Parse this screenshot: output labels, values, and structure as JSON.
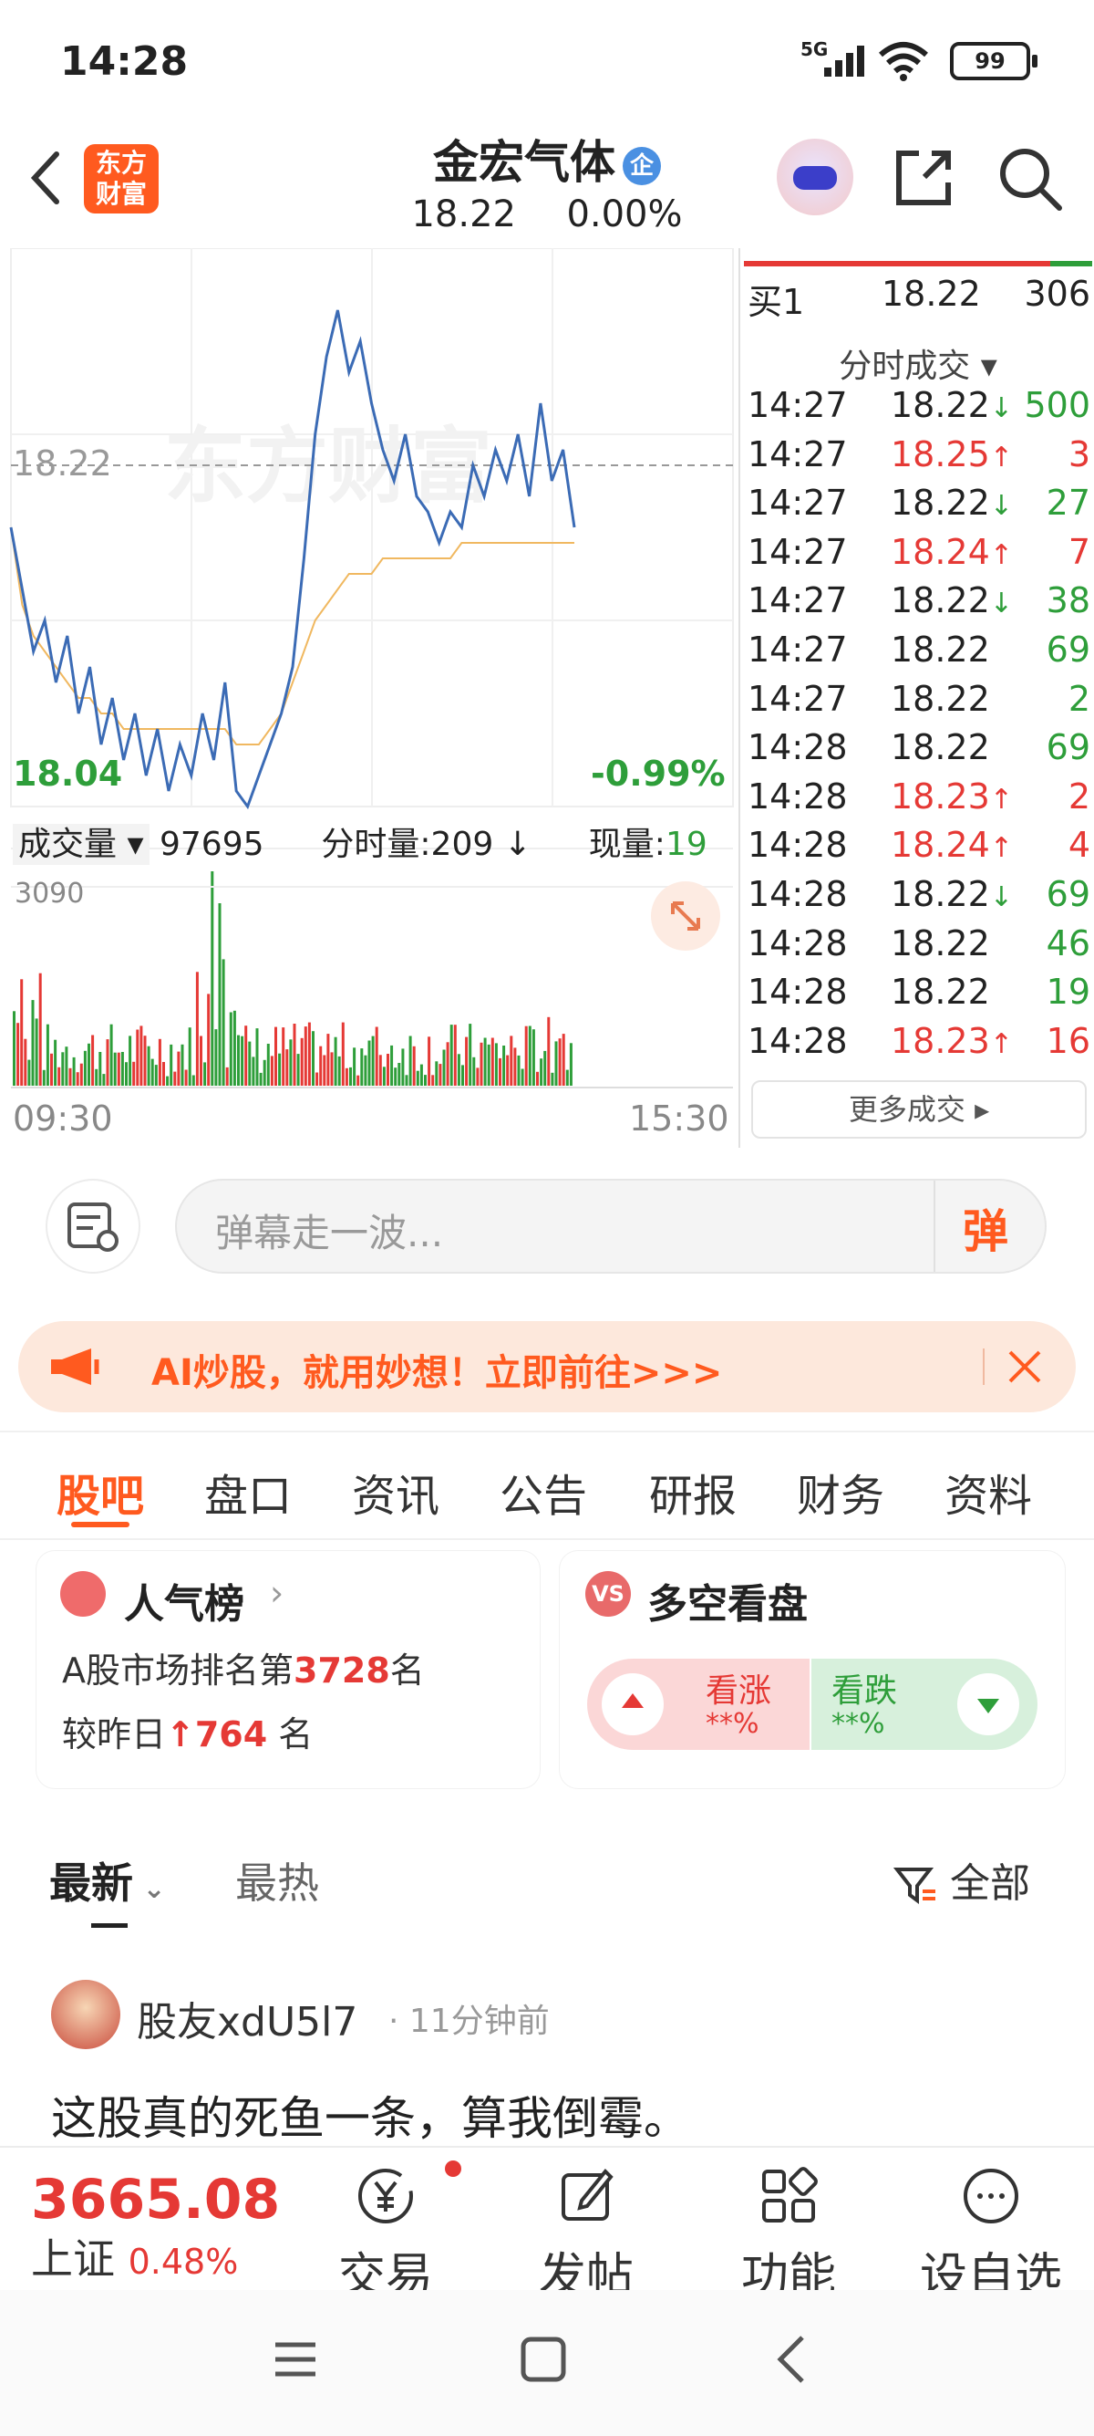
{
  "status": {
    "time": "14:28",
    "network": "5G",
    "battery": "99"
  },
  "header": {
    "logo_text_line1": "东方",
    "logo_text_line2": "财富",
    "stock_name": "金宏气体",
    "stock_tag": "企",
    "price": "18.22",
    "change_pct": "0.00%"
  },
  "chart": {
    "current_price_label": "18.22",
    "low_label": "18.04",
    "low_pct": "-0.99%",
    "volume_label": "成交量",
    "volume_value": "97695",
    "tick_volume_label": "分时量:209",
    "tick_volume_arrow": "↓",
    "now_volume_label": "现量:",
    "now_volume_value": "19",
    "vol_max": "3090",
    "time_start": "09:30",
    "time_end": "15:30",
    "watermark": "东方财富"
  },
  "chart_data": {
    "type": "line",
    "title": "",
    "series": [
      {
        "name": "",
        "values": [
          18.22,
          18.18,
          18.14,
          18.16,
          18.12,
          18.15,
          18.1,
          18.13,
          18.08,
          18.11,
          18.07,
          18.1,
          18.06,
          18.09,
          18.05,
          18.08,
          18.06,
          18.1,
          18.07,
          18.12,
          18.05,
          18.04,
          18.06,
          18.08,
          18.1,
          18.13,
          18.2,
          18.28,
          18.33,
          18.36,
          18.32,
          18.34,
          18.3,
          18.27,
          18.25,
          18.28,
          18.24,
          18.23,
          18.21,
          18.23,
          18.22,
          18.26,
          18.24,
          18.27,
          18.25,
          18.28,
          18.24,
          18.3,
          18.25,
          18.27,
          18.22
        ]
      },
      {
        "name": "",
        "values": [
          18.22,
          18.17,
          18.15,
          18.14,
          18.13,
          18.12,
          18.11,
          18.11,
          18.1,
          18.1,
          18.09,
          18.09,
          18.09,
          18.09,
          18.09,
          18.09,
          18.09,
          18.09,
          18.09,
          18.09,
          18.08,
          18.08,
          18.08,
          18.09,
          18.1,
          18.12,
          18.14,
          18.16,
          18.17,
          18.18,
          18.19,
          18.19,
          18.19,
          18.2,
          18.2,
          18.2,
          18.2,
          18.2,
          18.2,
          18.2,
          18.21,
          18.21,
          18.21,
          18.21,
          18.21,
          18.21,
          18.21,
          18.21,
          18.21,
          18.21,
          18.21
        ]
      }
    ],
    "ylim": [
      18.04,
      18.4
    ],
    "x_range": [
      "09:30",
      "15:30"
    ]
  },
  "orderbook": {
    "label": "买1",
    "price": "18.22",
    "vol": "306"
  },
  "trades_header": "分时成交",
  "trades": [
    {
      "time": "14:27",
      "price": "18.22",
      "arrow": "↓",
      "vol": "500",
      "color": "green"
    },
    {
      "time": "14:27",
      "price": "18.25",
      "arrow": "↑",
      "vol": "3",
      "color": "red"
    },
    {
      "time": "14:27",
      "price": "18.22",
      "arrow": "↓",
      "vol": "27",
      "color": "green"
    },
    {
      "time": "14:27",
      "price": "18.24",
      "arrow": "↑",
      "vol": "7",
      "color": "red"
    },
    {
      "time": "14:27",
      "price": "18.22",
      "arrow": "↓",
      "vol": "38",
      "color": "green"
    },
    {
      "time": "14:27",
      "price": "18.22",
      "arrow": "",
      "vol": "69",
      "color": "green"
    },
    {
      "time": "14:27",
      "price": "18.22",
      "arrow": "",
      "vol": "2",
      "color": "green"
    },
    {
      "time": "14:28",
      "price": "18.22",
      "arrow": "",
      "vol": "69",
      "color": "green"
    },
    {
      "time": "14:28",
      "price": "18.23",
      "arrow": "↑",
      "vol": "2",
      "color": "red"
    },
    {
      "time": "14:28",
      "price": "18.24",
      "arrow": "↑",
      "vol": "4",
      "color": "red"
    },
    {
      "time": "14:28",
      "price": "18.22",
      "arrow": "↓",
      "vol": "69",
      "color": "green"
    },
    {
      "time": "14:28",
      "price": "18.22",
      "arrow": "",
      "vol": "46",
      "color": "green"
    },
    {
      "time": "14:28",
      "price": "18.22",
      "arrow": "",
      "vol": "19",
      "color": "green"
    },
    {
      "time": "14:28",
      "price": "18.23",
      "arrow": "↑",
      "vol": "16",
      "color": "red"
    }
  ],
  "more_trades": "更多成交",
  "barrage": {
    "placeholder": "弹幕走一波...",
    "button": "弹"
  },
  "ad": {
    "text": "AI炒股，就用妙想！立即前往>>>"
  },
  "tabs": [
    "股吧",
    "盘口",
    "资讯",
    "公告",
    "研报",
    "财务",
    "资料"
  ],
  "rank_card": {
    "title": "人气榜",
    "line1_prefix": "A股市场排名第",
    "rank": "3728",
    "line1_suffix": "名",
    "line2_prefix": "较昨日",
    "change": "764",
    "line2_suffix": "名"
  },
  "vs_card": {
    "title": "多空看盘",
    "up_label": "看涨",
    "up_pct": "**%",
    "down_label": "看跌",
    "down_pct": "**%"
  },
  "sort": {
    "latest": "最新",
    "hot": "最热",
    "filter": "全部"
  },
  "post": {
    "author": "股友xdU5l7",
    "time": "11分钟前",
    "content": "这股真的死鱼一条，算我倒霉。"
  },
  "bottom": {
    "index_value": "3665.08",
    "index_name": "上证",
    "index_pct": "0.48%",
    "trade": "交易",
    "post": "发帖",
    "function": "功能",
    "watch": "设自选"
  },
  "colors": {
    "up": "#e53935",
    "down": "#2e9e3a",
    "accent": "#ff5a1f",
    "price_line": "#3b6bb5",
    "avg_line": "#f0b860"
  }
}
